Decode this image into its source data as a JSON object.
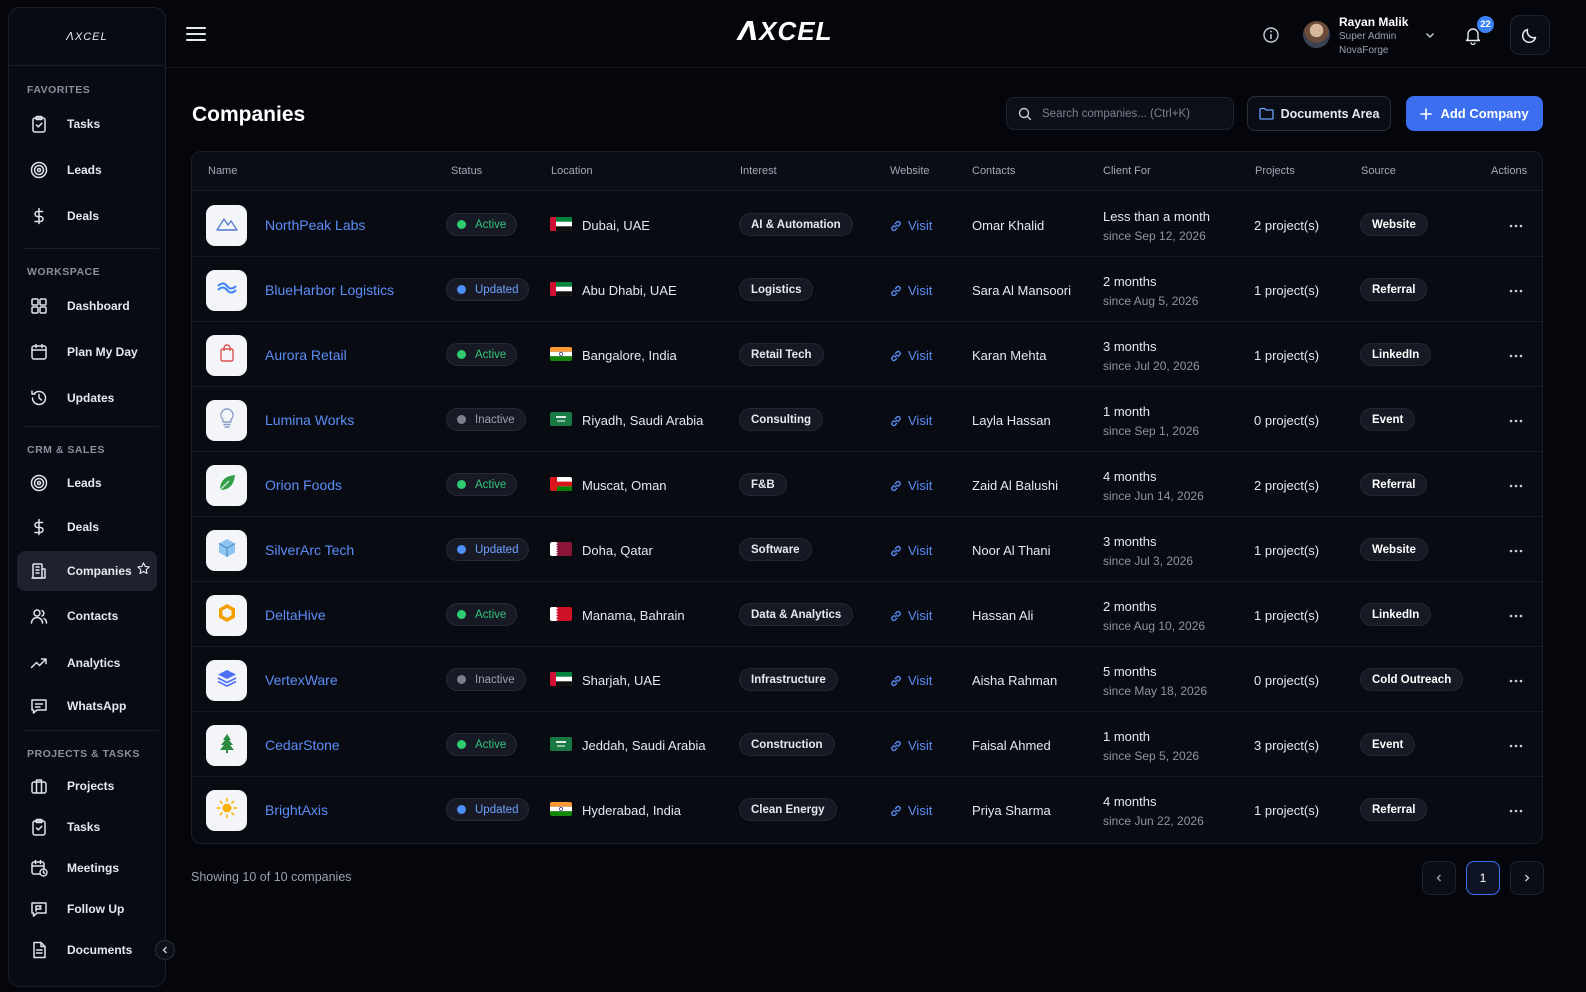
{
  "app": {
    "brand": "ᐱXCEL",
    "sidebar_logo": "ᐱXCEL"
  },
  "user": {
    "name": "Rayan Malik",
    "role": "Super Admin",
    "org": "NovaForge",
    "notifications": "22"
  },
  "sidebar": {
    "sections": [
      {
        "title": "FAVORITES",
        "items": [
          {
            "label": "Tasks",
            "icon": "clipboard-check-icon"
          },
          {
            "label": "Leads",
            "icon": "target-icon"
          },
          {
            "label": "Deals",
            "icon": "dollar-icon"
          }
        ]
      },
      {
        "title": "WORKSPACE",
        "items": [
          {
            "label": "Dashboard",
            "icon": "grid-icon"
          },
          {
            "label": "Plan My Day",
            "icon": "calendar-icon"
          },
          {
            "label": "Updates",
            "icon": "history-icon"
          }
        ]
      },
      {
        "title": "CRM & SALES",
        "items": [
          {
            "label": "Leads",
            "icon": "target-icon"
          },
          {
            "label": "Deals",
            "icon": "dollar-icon"
          },
          {
            "label": "Companies",
            "icon": "building-icon",
            "active": true
          },
          {
            "label": "Contacts",
            "icon": "users-icon"
          },
          {
            "label": "Analytics",
            "icon": "trend-icon"
          },
          {
            "label": "WhatsApp",
            "icon": "chat-icon"
          }
        ]
      },
      {
        "title": "PROJECTS & TASKS",
        "items": [
          {
            "label": "Projects",
            "icon": "briefcase-icon"
          },
          {
            "label": "Tasks",
            "icon": "clipboard-check-icon"
          },
          {
            "label": "Meetings",
            "icon": "calendar-clock-icon"
          },
          {
            "label": "Follow Up",
            "icon": "message-flag-icon"
          },
          {
            "label": "Documents",
            "icon": "document-icon"
          }
        ]
      }
    ]
  },
  "page": {
    "title": "Companies",
    "search_placeholder": "Search companies... (Ctrl+K)",
    "documents_button": "Documents Area",
    "add_button": "Add Company"
  },
  "table": {
    "columns": [
      "Name",
      "Status",
      "Location",
      "Interest",
      "Website",
      "Contacts",
      "Client For",
      "Projects",
      "Source",
      "Actions"
    ],
    "rows": [
      {
        "name": "NorthPeak Labs",
        "status": "Active",
        "status_kind": "active",
        "location": "Dubai, UAE",
        "flag": "uae",
        "interest": "AI & Automation",
        "website": "Visit",
        "contact": "Omar Khalid",
        "client_for": "Less than a month",
        "since": "since Sep 12, 2026",
        "projects": "2 project(s)",
        "source": "Website",
        "logo": "mountain-logo"
      },
      {
        "name": "BlueHarbor Logistics",
        "status": "Updated",
        "status_kind": "updated",
        "location": "Abu Dhabi, UAE",
        "flag": "uae",
        "interest": "Logistics",
        "website": "Visit",
        "contact": "Sara Al Mansoori",
        "client_for": "2 months",
        "since": "since Aug 5, 2026",
        "projects": "1 project(s)",
        "source": "Referral",
        "logo": "waves-logo"
      },
      {
        "name": "Aurora Retail",
        "status": "Active",
        "status_kind": "active",
        "location": "Bangalore, India",
        "flag": "india",
        "interest": "Retail Tech",
        "website": "Visit",
        "contact": "Karan Mehta",
        "client_for": "3 months",
        "since": "since Jul 20, 2026",
        "projects": "1 project(s)",
        "source": "LinkedIn",
        "logo": "shopping-bag-logo"
      },
      {
        "name": "Lumina Works",
        "status": "Inactive",
        "status_kind": "inactive",
        "location": "Riyadh, Saudi Arabia",
        "flag": "saudi",
        "interest": "Consulting",
        "website": "Visit",
        "contact": "Layla Hassan",
        "client_for": "1 month",
        "since": "since Sep 1, 2026",
        "projects": "0 project(s)",
        "source": "Event",
        "logo": "lightbulb-logo"
      },
      {
        "name": "Orion Foods",
        "status": "Active",
        "status_kind": "active",
        "location": "Muscat, Oman",
        "flag": "oman",
        "interest": "F&B",
        "website": "Visit",
        "contact": "Zaid Al Balushi",
        "client_for": "4 months",
        "since": "since Jun 14, 2026",
        "projects": "2 project(s)",
        "source": "Referral",
        "logo": "leaf-logo"
      },
      {
        "name": "SilverArc Tech",
        "status": "Updated",
        "status_kind": "updated",
        "location": "Doha, Qatar",
        "flag": "qatar",
        "interest": "Software",
        "website": "Visit",
        "contact": "Noor Al Thani",
        "client_for": "3 months",
        "since": "since Jul 3, 2026",
        "projects": "1 project(s)",
        "source": "Website",
        "logo": "cube-logo"
      },
      {
        "name": "DeltaHive",
        "status": "Active",
        "status_kind": "active",
        "location": "Manama, Bahrain",
        "flag": "bahrain",
        "interest": "Data & Analytics",
        "website": "Visit",
        "contact": "Hassan Ali",
        "client_for": "2 months",
        "since": "since Aug 10, 2026",
        "projects": "1 project(s)",
        "source": "LinkedIn",
        "logo": "hexagon-logo"
      },
      {
        "name": "VertexWare",
        "status": "Inactive",
        "status_kind": "inactive",
        "location": "Sharjah, UAE",
        "flag": "uae",
        "interest": "Infrastructure",
        "website": "Visit",
        "contact": "Aisha Rahman",
        "client_for": "5 months",
        "since": "since May 18, 2026",
        "projects": "0 project(s)",
        "source": "Cold Outreach",
        "logo": "layers-logo"
      },
      {
        "name": "CedarStone",
        "status": "Active",
        "status_kind": "active",
        "location": "Jeddah, Saudi Arabia",
        "flag": "saudi",
        "interest": "Construction",
        "website": "Visit",
        "contact": "Faisal Ahmed",
        "client_for": "1 month",
        "since": "since Sep 5, 2026",
        "projects": "3 project(s)",
        "source": "Event",
        "logo": "tree-logo"
      },
      {
        "name": "BrightAxis",
        "status": "Updated",
        "status_kind": "updated",
        "location": "Hyderabad, India",
        "flag": "india",
        "interest": "Clean Energy",
        "website": "Visit",
        "contact": "Priya Sharma",
        "client_for": "4 months",
        "since": "since Jun 22, 2026",
        "projects": "1 project(s)",
        "source": "Referral",
        "logo": "sun-logo"
      }
    ]
  },
  "footer": {
    "showing": "Showing 10 of 10 companies",
    "current_page": "1"
  },
  "colors": {
    "accent": "#3b6ff0",
    "link": "#5b8df5",
    "active": "#2ecc71",
    "updated": "#4f8ef7",
    "inactive": "#7a7f8d",
    "background": "#05060c"
  }
}
